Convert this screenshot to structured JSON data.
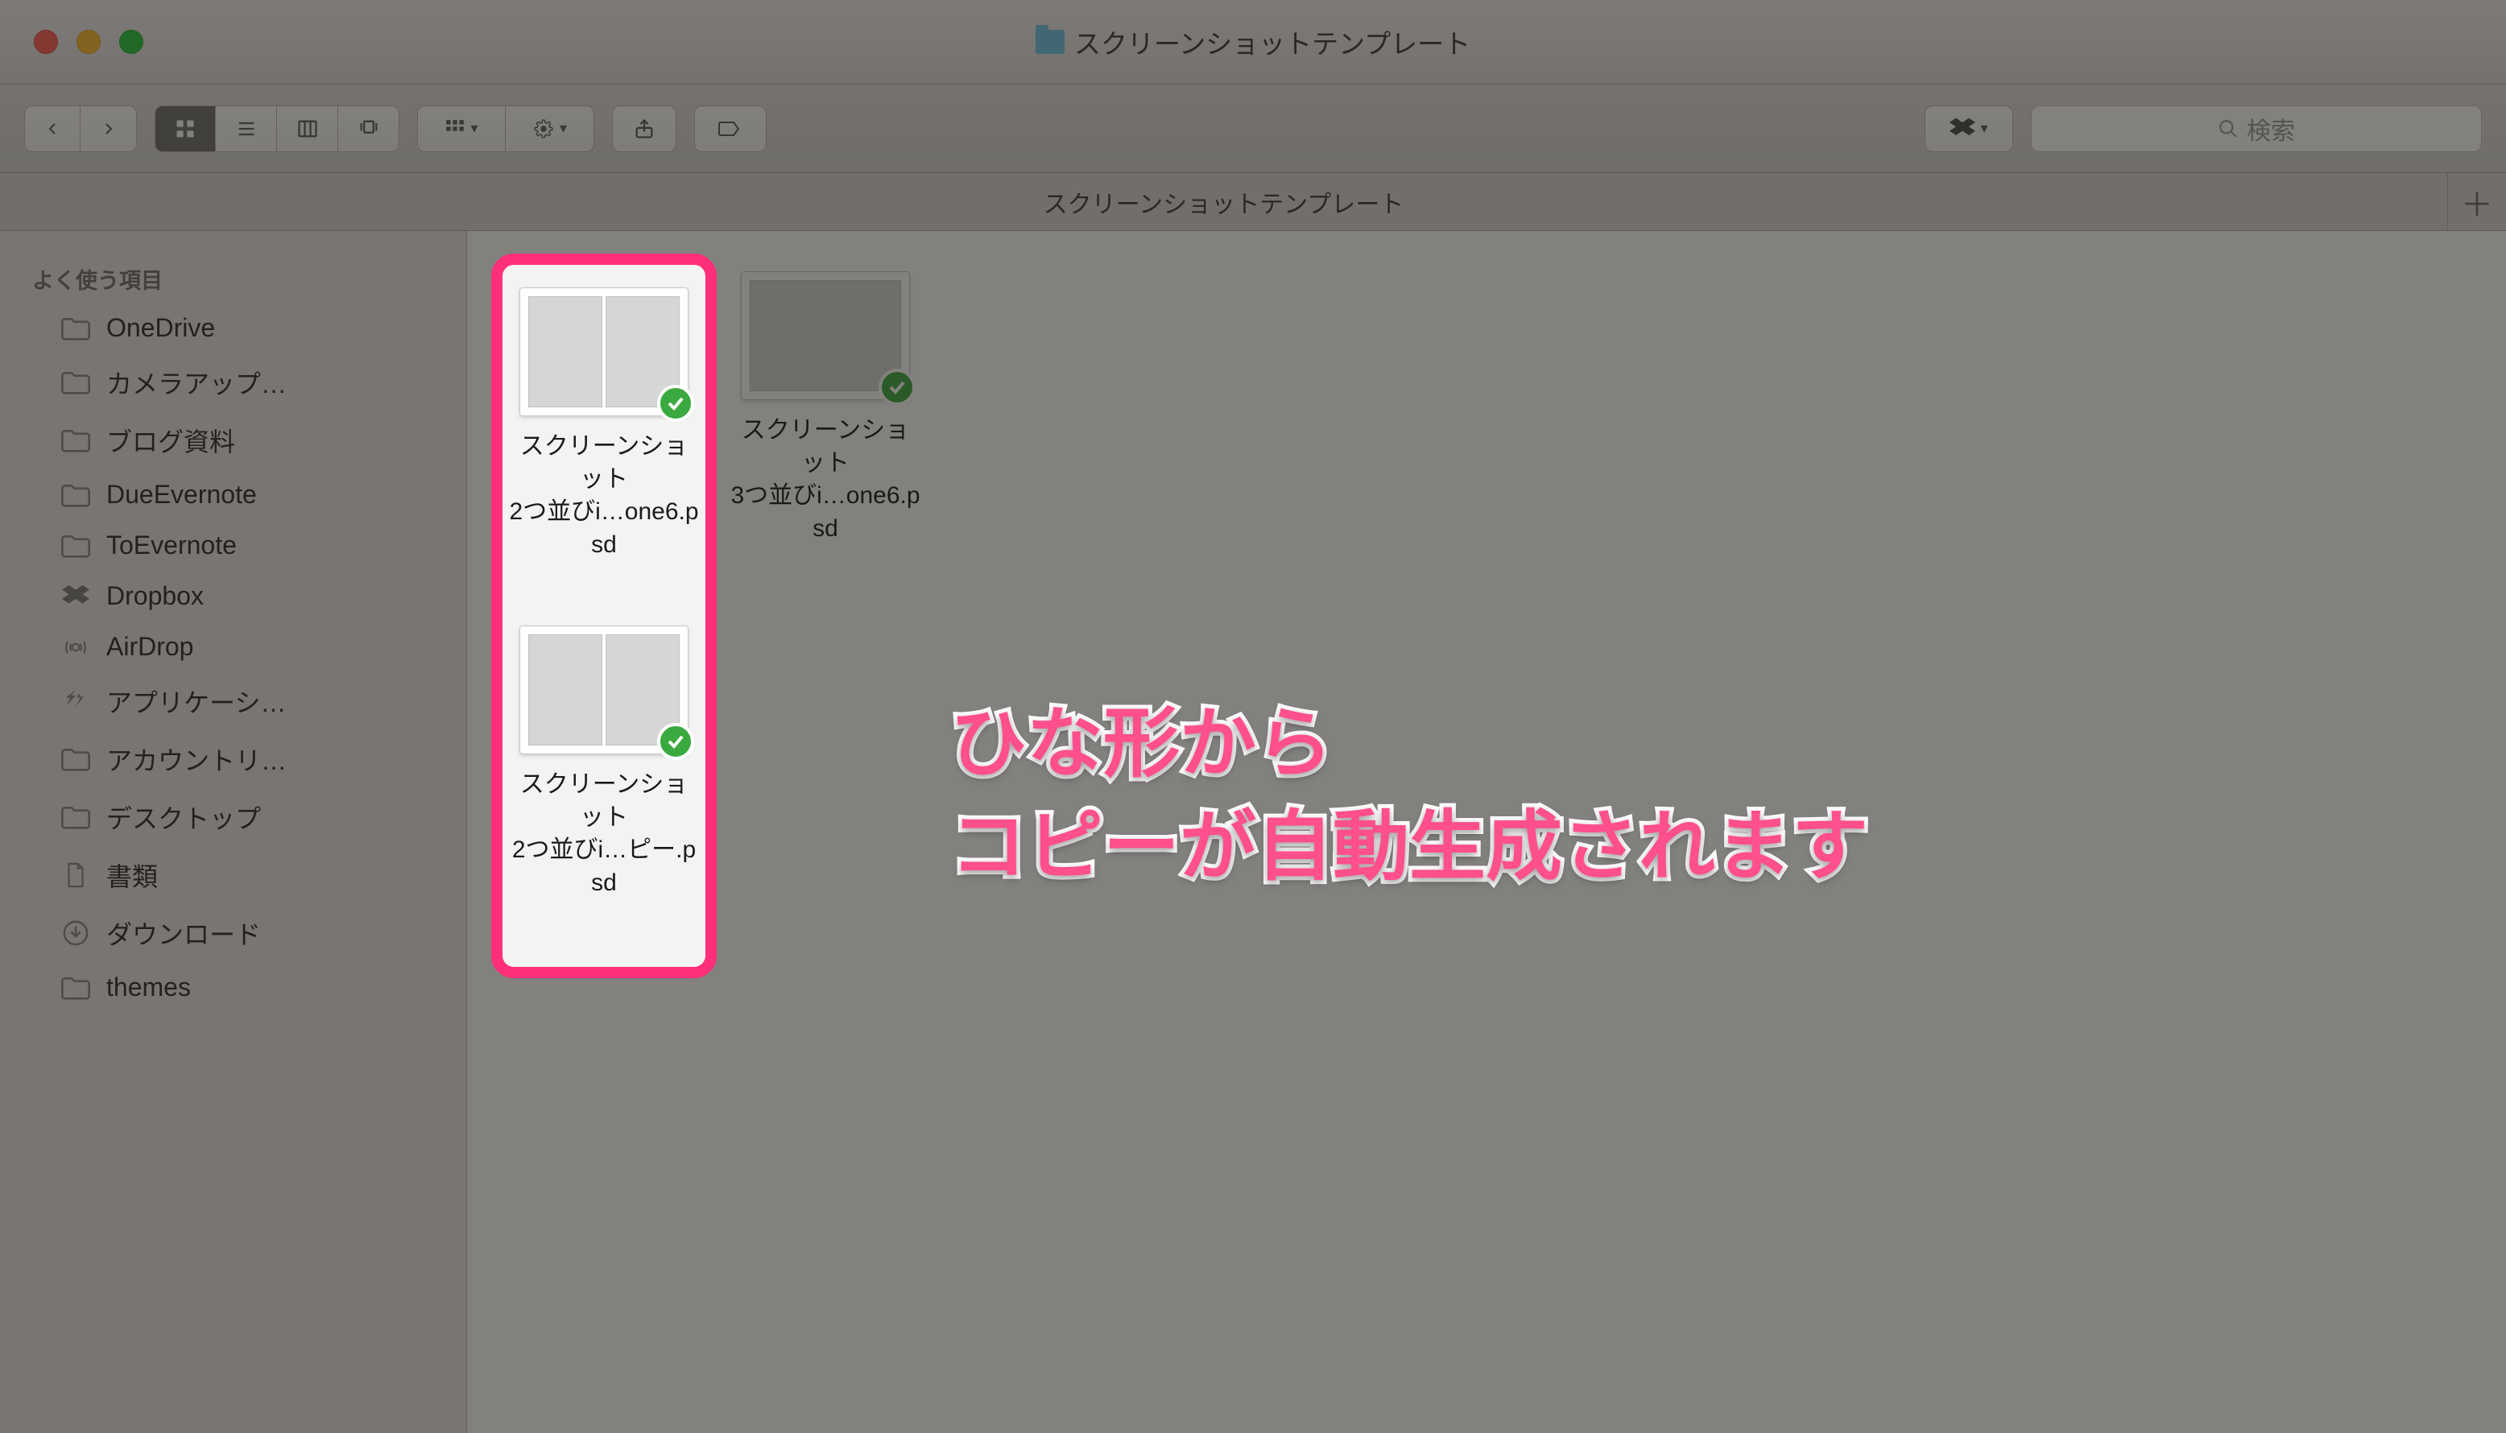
{
  "window": {
    "title": "スクリーンショットテンプレート"
  },
  "toolbar": {
    "search_placeholder": "検索"
  },
  "tabbar": {
    "tab_label": "スクリーンショットテンプレート"
  },
  "sidebar": {
    "header": "よく使う項目",
    "items": [
      {
        "label": "OneDrive",
        "icon": "folder"
      },
      {
        "label": "カメラアップ…",
        "icon": "folder"
      },
      {
        "label": "ブログ資料",
        "icon": "folder"
      },
      {
        "label": "DueEvernote",
        "icon": "folder"
      },
      {
        "label": "ToEvernote",
        "icon": "folder"
      },
      {
        "label": "Dropbox",
        "icon": "dropbox"
      },
      {
        "label": "AirDrop",
        "icon": "airdrop"
      },
      {
        "label": "アプリケーシ…",
        "icon": "apps"
      },
      {
        "label": "アカウントリ…",
        "icon": "folder"
      },
      {
        "label": "デスクトップ",
        "icon": "folder"
      },
      {
        "label": "書類",
        "icon": "document"
      },
      {
        "label": "ダウンロード",
        "icon": "download"
      },
      {
        "label": "themes",
        "icon": "folder"
      }
    ]
  },
  "files": {
    "grid": [
      {
        "name_line1": "スクリーンショット",
        "name_line2": "3つ並びi…one6.psd",
        "thumb": "single",
        "synced": true
      }
    ],
    "highlighted": [
      {
        "name_line1": "スクリーンショット",
        "name_line2": "2つ並びi…one6.psd",
        "thumb": "double",
        "synced": true
      },
      {
        "name_line1": "スクリーンショット",
        "name_line2": "2つ並びi…ピー.psd",
        "thumb": "double",
        "synced": true
      }
    ]
  },
  "annotation": {
    "line1": "ひな形から",
    "line2": "コピーが自動生成されます"
  }
}
